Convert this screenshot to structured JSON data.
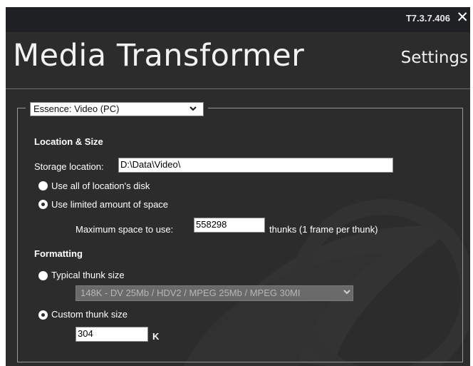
{
  "window": {
    "version": "T7.3.7.406",
    "close_glyph": "✕",
    "app_title": "Media Transformer",
    "page_title": "Settings"
  },
  "essence": {
    "selected": "Essence: Video (PC)",
    "chevron_glyph": "⌄"
  },
  "location_size": {
    "heading": "Location & Size",
    "storage_label": "Storage location:",
    "storage_value": "D:\\Data\\Video\\",
    "option_all_disk": "Use all of location's disk",
    "option_limited": "Use limited amount of space",
    "selected_option": "limited",
    "max_space_label": "Maximum space to use:",
    "max_space_value": "558298",
    "max_space_units": "thunks (1 frame per thunk)"
  },
  "formatting": {
    "heading": "Formatting",
    "option_typical": "Typical thunk size",
    "typical_selected": "148K - DV 25Mb / HDV2 / MPEG 25Mb / MPEG 30MI",
    "option_custom": "Custom thunk size",
    "selected_option": "custom",
    "custom_value": "304",
    "custom_units": "K"
  },
  "colors": {
    "window_bg": "#2c2c2c",
    "titlebar_bg": "#1f2024",
    "text": "#ffffff",
    "disabled_bg": "#6a6a6a"
  }
}
